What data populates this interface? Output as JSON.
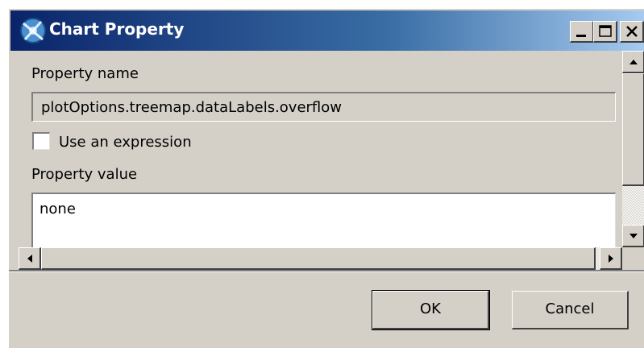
{
  "window": {
    "title": "Chart Property",
    "controls": {
      "minimize": "minimize",
      "maximize": "maximize",
      "close": "close"
    }
  },
  "property_name": {
    "label": "Property name",
    "value": "plotOptions.treemap.dataLabels.overflow"
  },
  "use_expression": {
    "label": "Use an expression",
    "checked": false
  },
  "property_value": {
    "label": "Property value",
    "value": "none"
  },
  "buttons": {
    "ok": "OK",
    "cancel": "Cancel"
  },
  "colors": {
    "titlebar_start": "#0a246a",
    "titlebar_end": "#a6caf0",
    "face": "#d4d0c8"
  }
}
